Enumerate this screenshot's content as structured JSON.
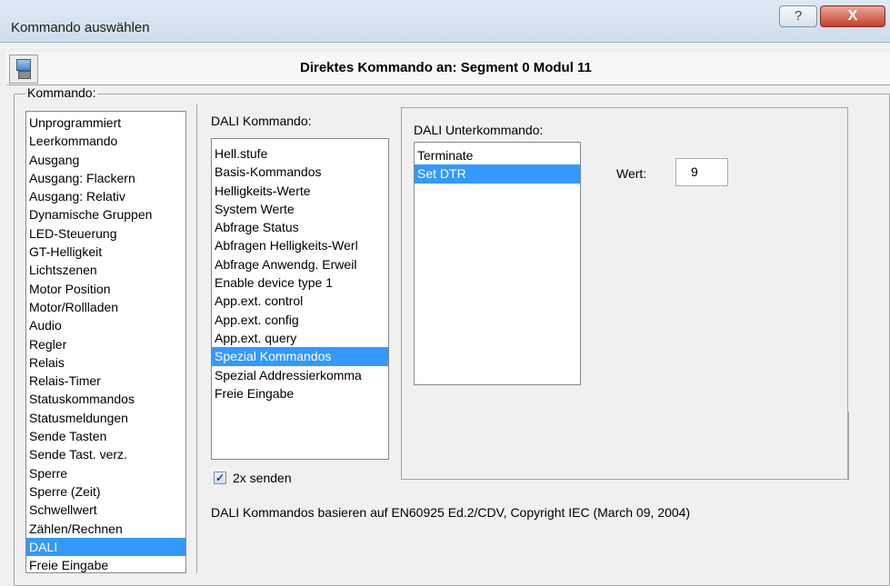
{
  "window": {
    "title": "Kommando auswählen",
    "help_glyph": "?",
    "close_glyph": "X"
  },
  "header": {
    "title": "Direktes Kommando an: Segment 0 Modul 11",
    "device_icon": "monitor-icon"
  },
  "kommando": {
    "label": "Kommando:",
    "items": [
      "Unprogrammiert",
      "Leerkommando",
      "Ausgang",
      "Ausgang: Flackern",
      "Ausgang: Relativ",
      "Dynamische Gruppen",
      "LED-Steuerung",
      "GT-Helligkeit",
      "Lichtszenen",
      "Motor Position",
      "Motor/Rollladen",
      "Audio",
      "Regler",
      "Relais",
      "Relais-Timer",
      "Statuskommandos",
      "Statusmeldungen",
      "Sende Tasten",
      "Sende Tast. verz.",
      "Sperre",
      "Sperre (Zeit)",
      "Schwellwert",
      "Zählen/Rechnen",
      "DALI",
      "Freie Eingabe"
    ],
    "selected": "DALI"
  },
  "dali": {
    "label": "DALI Kommando:",
    "items": [
      "Hell.stufe",
      "Basis-Kommandos",
      "Helligkeits-Werte",
      "System Werte",
      "Abfrage Status",
      "Abfragen Helligkeits-Werl",
      "Abfrage Anwendg. Erweil",
      "Enable device type 1",
      "App.ext. control",
      "App.ext. config",
      "App.ext. query",
      "Spezial Kommandos",
      "Spezial Addressierkomma",
      "Freie Eingabe"
    ],
    "selected": "Spezial Kommandos"
  },
  "sub": {
    "label": "DALI Unterkommando:",
    "items": [
      "Terminate",
      "Set DTR"
    ],
    "selected": "Set DTR",
    "wert_label": "Wert:",
    "wert_value": "9"
  },
  "send_twice": {
    "checked": true,
    "label": "2x senden"
  },
  "footer_note": "DALI Kommandos basieren auf EN60925 Ed.2/CDV, Copyright IEC (March 09, 2004)",
  "colors": {
    "selection": "#3399ff",
    "close_button": "#c7402b"
  }
}
